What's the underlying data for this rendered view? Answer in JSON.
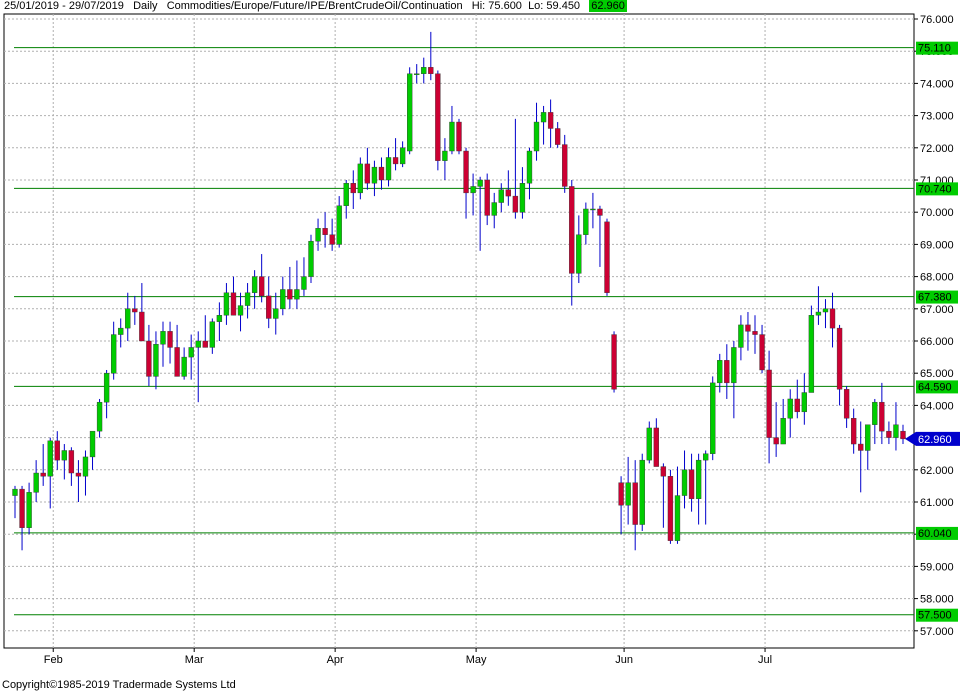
{
  "header": {
    "range": "25/01/2019 - 29/07/2019",
    "period": "Daily",
    "symbol": "Commodities/Europe/Future/IPE/BrentCrudeOil/Continuation",
    "hi": "Hi: 75.600",
    "lo": "Lo: 59.450",
    "last": "62.960"
  },
  "footer": {
    "copyright": "Copyright©1985-2019 Tradermade Systems Ltd"
  },
  "chart_data": {
    "type": "candlestick",
    "y_axis_side": "right",
    "ylim": [
      56.5,
      76.3
    ],
    "y_ticks": [
      "76.000",
      "75.000",
      "74.000",
      "73.000",
      "72.000",
      "71.000",
      "70.000",
      "69.000",
      "68.000",
      "67.000",
      "66.000",
      "65.000",
      "64.000",
      "63.000",
      "62.000",
      "61.000",
      "60.000",
      "59.000",
      "58.000",
      "57.000"
    ],
    "x_labels": [
      "Feb",
      "Mar",
      "Apr",
      "May",
      "Jun",
      "Jul"
    ],
    "month_start_index": [
      5,
      25,
      45,
      65,
      86,
      106
    ],
    "grid": true,
    "colors": {
      "up": "#00cc00",
      "down": "#cc0033",
      "wick": "#0000cc",
      "hline": "#008000",
      "last_price": "#0000cc"
    },
    "horizontal_lines": [
      75.11,
      70.74,
      67.38,
      64.59,
      60.04,
      57.5
    ],
    "horizontal_line_labels": [
      "75.110",
      "70.740",
      "67.380",
      "64.590",
      "60.040",
      "57.500"
    ],
    "last_price": 62.96,
    "last_price_label": "62.960",
    "ohlc": [
      [
        61.2,
        61.5,
        60.5,
        61.4
      ],
      [
        61.4,
        61.5,
        59.5,
        60.2
      ],
      [
        60.2,
        61.6,
        60.0,
        61.3
      ],
      [
        61.3,
        62.3,
        61.0,
        61.9
      ],
      [
        61.9,
        62.8,
        61.5,
        61.8
      ],
      [
        61.8,
        63.0,
        60.8,
        62.9
      ],
      [
        62.9,
        63.2,
        62.0,
        62.3
      ],
      [
        62.3,
        62.8,
        61.7,
        62.6
      ],
      [
        62.6,
        62.7,
        61.5,
        61.9
      ],
      [
        61.9,
        62.3,
        61.0,
        61.8
      ],
      [
        61.8,
        62.6,
        61.2,
        62.4
      ],
      [
        62.4,
        63.1,
        62.0,
        63.2
      ],
      [
        63.2,
        64.2,
        63.0,
        64.1
      ],
      [
        64.1,
        65.1,
        63.6,
        65.0
      ],
      [
        65.0,
        66.6,
        64.8,
        66.2
      ],
      [
        66.2,
        66.7,
        65.8,
        66.4
      ],
      [
        66.4,
        67.5,
        66.0,
        67.0
      ],
      [
        67.0,
        67.4,
        66.5,
        66.9
      ],
      [
        66.9,
        67.8,
        66.5,
        66.0
      ],
      [
        66.0,
        66.5,
        64.6,
        64.9
      ],
      [
        64.9,
        66.3,
        64.5,
        65.9
      ],
      [
        65.9,
        66.6,
        65.2,
        66.3
      ],
      [
        66.3,
        66.6,
        65.3,
        65.8
      ],
      [
        65.8,
        66.5,
        64.9,
        64.9
      ],
      [
        64.9,
        65.8,
        64.8,
        65.5
      ],
      [
        65.5,
        66.2,
        64.8,
        65.8
      ],
      [
        65.8,
        66.3,
        64.1,
        66.0
      ],
      [
        66.0,
        66.8,
        65.8,
        65.8
      ],
      [
        65.8,
        66.7,
        65.6,
        66.6
      ],
      [
        66.6,
        67.2,
        66.0,
        66.8
      ],
      [
        66.8,
        67.8,
        66.5,
        67.5
      ],
      [
        67.5,
        68.0,
        66.8,
        66.8
      ],
      [
        66.8,
        67.5,
        66.3,
        67.1
      ],
      [
        67.1,
        67.8,
        66.7,
        67.5
      ],
      [
        67.5,
        68.2,
        67.0,
        68.0
      ],
      [
        68.0,
        68.7,
        67.2,
        67.4
      ],
      [
        67.4,
        68.0,
        66.4,
        66.7
      ],
      [
        66.7,
        67.5,
        66.2,
        67.0
      ],
      [
        67.0,
        68.0,
        66.8,
        67.6
      ],
      [
        67.6,
        68.3,
        67.0,
        67.3
      ],
      [
        67.3,
        68.5,
        67.0,
        67.6
      ],
      [
        67.6,
        68.6,
        67.4,
        68.0
      ],
      [
        68.0,
        69.3,
        67.8,
        69.1
      ],
      [
        69.1,
        69.8,
        68.8,
        69.5
      ],
      [
        69.5,
        70.0,
        68.9,
        69.3
      ],
      [
        69.3,
        69.8,
        68.8,
        69.0
      ],
      [
        69.0,
        70.5,
        68.9,
        70.2
      ],
      [
        70.2,
        71.0,
        69.8,
        70.9
      ],
      [
        70.9,
        71.3,
        70.1,
        70.6
      ],
      [
        70.6,
        71.7,
        70.4,
        71.5
      ],
      [
        71.5,
        72.0,
        70.7,
        70.9
      ],
      [
        70.9,
        71.6,
        70.5,
        71.4
      ],
      [
        71.4,
        71.7,
        70.7,
        71.0
      ],
      [
        71.0,
        72.0,
        70.8,
        71.7
      ],
      [
        71.7,
        72.3,
        71.3,
        71.5
      ],
      [
        71.5,
        72.2,
        71.4,
        72.0
      ],
      [
        71.9,
        74.5,
        71.8,
        74.3
      ],
      [
        74.3,
        74.6,
        74.0,
        74.3
      ],
      [
        74.3,
        74.8,
        74.0,
        74.5
      ],
      [
        74.5,
        75.6,
        74.1,
        74.3
      ],
      [
        74.3,
        74.4,
        71.3,
        71.6
      ],
      [
        71.6,
        72.3,
        71.0,
        71.9
      ],
      [
        71.9,
        73.3,
        71.8,
        72.8
      ],
      [
        72.8,
        72.9,
        71.8,
        71.9
      ],
      [
        71.9,
        72.0,
        69.8,
        70.6
      ],
      [
        70.6,
        71.2,
        69.9,
        70.8
      ],
      [
        70.8,
        71.1,
        68.8,
        71.0
      ],
      [
        71.0,
        71.2,
        69.6,
        69.9
      ],
      [
        69.9,
        70.6,
        69.5,
        70.3
      ],
      [
        70.3,
        70.9,
        70.0,
        70.7
      ],
      [
        70.7,
        71.3,
        70.2,
        70.5
      ],
      [
        70.5,
        72.9,
        69.8,
        70.0
      ],
      [
        70.0,
        71.4,
        69.8,
        70.9
      ],
      [
        70.9,
        72.0,
        70.4,
        71.9
      ],
      [
        71.9,
        73.4,
        71.6,
        72.8
      ],
      [
        72.8,
        73.3,
        72.1,
        73.1
      ],
      [
        73.1,
        73.5,
        72.0,
        72.6
      ],
      [
        72.6,
        72.8,
        72.0,
        72.1
      ],
      [
        72.1,
        72.4,
        70.6,
        70.8
      ],
      [
        70.8,
        71.0,
        67.1,
        68.1
      ],
      [
        68.1,
        69.9,
        67.8,
        69.3
      ],
      [
        69.3,
        70.3,
        69.0,
        70.1
      ],
      [
        70.1,
        70.6,
        69.5,
        70.1
      ],
      [
        70.1,
        70.2,
        68.3,
        69.9
      ],
      [
        69.7,
        69.8,
        67.4,
        67.5
      ],
      [
        66.2,
        66.3,
        64.4,
        64.5
      ],
      [
        61.6,
        61.8,
        60.0,
        60.9
      ],
      [
        60.9,
        62.4,
        60.3,
        61.6
      ],
      [
        61.6,
        62.3,
        59.5,
        60.3
      ],
      [
        60.3,
        62.5,
        60.1,
        62.3
      ],
      [
        62.3,
        63.5,
        62.2,
        63.3
      ],
      [
        63.3,
        63.6,
        62.2,
        62.1
      ],
      [
        62.1,
        62.2,
        60.2,
        61.8
      ],
      [
        61.8,
        62.0,
        59.7,
        59.8
      ],
      [
        59.8,
        62.1,
        59.7,
        61.2
      ],
      [
        61.2,
        62.6,
        60.8,
        62.0
      ],
      [
        62.0,
        62.5,
        60.7,
        61.1
      ],
      [
        61.1,
        62.5,
        60.3,
        62.3
      ],
      [
        62.3,
        62.6,
        60.3,
        62.5
      ],
      [
        62.5,
        64.9,
        62.3,
        64.7
      ],
      [
        64.7,
        65.6,
        64.4,
        65.4
      ],
      [
        65.4,
        65.9,
        64.2,
        64.7
      ],
      [
        64.7,
        66.0,
        63.6,
        65.8
      ],
      [
        65.8,
        66.8,
        65.4,
        66.5
      ],
      [
        66.5,
        66.9,
        65.7,
        66.3
      ],
      [
        66.3,
        66.8,
        65.6,
        66.2
      ],
      [
        66.2,
        66.5,
        65.0,
        65.1
      ],
      [
        65.1,
        65.7,
        62.2,
        63.0
      ],
      [
        63.0,
        64.1,
        62.4,
        62.8
      ],
      [
        62.8,
        64.2,
        62.9,
        63.6
      ],
      [
        63.6,
        64.5,
        63.0,
        64.2
      ],
      [
        64.2,
        64.8,
        63.6,
        63.8
      ],
      [
        63.8,
        65.0,
        63.4,
        64.4
      ],
      [
        64.4,
        67.1,
        64.5,
        66.8
      ],
      [
        66.8,
        67.7,
        66.5,
        66.9
      ],
      [
        66.9,
        67.3,
        66.4,
        67.0
      ],
      [
        67.0,
        67.5,
        65.8,
        66.4
      ],
      [
        66.4,
        66.5,
        64.0,
        64.5
      ],
      [
        64.5,
        64.6,
        63.3,
        63.6
      ],
      [
        63.6,
        63.9,
        62.5,
        62.8
      ],
      [
        62.8,
        63.5,
        61.3,
        62.6
      ],
      [
        62.6,
        63.3,
        62.0,
        63.4
      ],
      [
        63.4,
        64.2,
        62.8,
        64.1
      ],
      [
        64.1,
        64.7,
        62.8,
        63.2
      ],
      [
        63.2,
        63.5,
        62.8,
        63.0
      ],
      [
        63.0,
        64.1,
        62.6,
        63.4
      ],
      [
        63.2,
        63.4,
        62.8,
        62.96
      ]
    ]
  }
}
